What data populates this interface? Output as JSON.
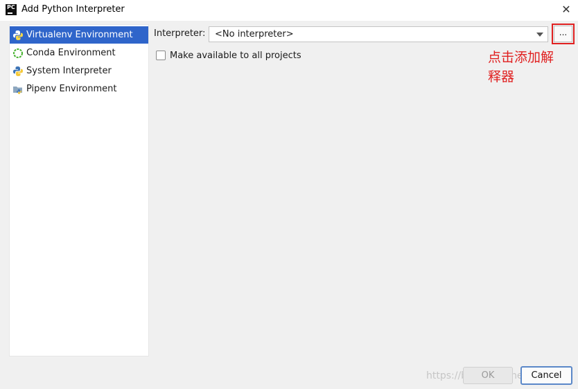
{
  "window": {
    "app_icon_text": "PC",
    "title": "Add Python Interpreter",
    "close_glyph": "✕"
  },
  "sidebar": {
    "items": [
      {
        "label": "Virtualenv Environment",
        "icon": "virtualenv-icon",
        "selected": true
      },
      {
        "label": "Conda Environment",
        "icon": "conda-icon",
        "selected": false
      },
      {
        "label": "System Interpreter",
        "icon": "python-icon",
        "selected": false
      },
      {
        "label": "Pipenv Environment",
        "icon": "pipenv-icon",
        "selected": false
      }
    ]
  },
  "main": {
    "interpreter_label": "Interpreter:",
    "interpreter_value": "<No interpreter>",
    "browse_label": "...",
    "make_available_label": "Make available to all projects",
    "make_available_checked": false
  },
  "annotation": {
    "text": "点击添加解释器",
    "color": "#e02020"
  },
  "footer": {
    "ok_label": "OK",
    "cancel_label": "Cancel"
  },
  "watermark": "https://blog.csdn.net/PHanger",
  "colors": {
    "selection": "#2f65ca",
    "highlight_box": "#e02020"
  }
}
